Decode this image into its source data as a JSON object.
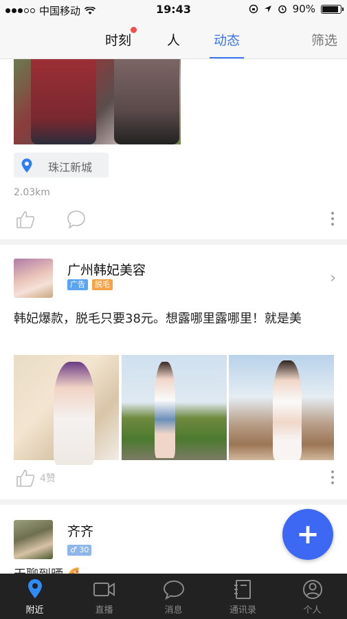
{
  "status_bar": {
    "carrier": "中国移动",
    "time": "19:43",
    "battery": "90%"
  },
  "nav": {
    "tabs": [
      {
        "label": "时刻"
      },
      {
        "label": "人"
      },
      {
        "label": "动态"
      }
    ],
    "filter_label": "筛选"
  },
  "feed": {
    "first_post": {
      "location": "珠江新城",
      "distance": "2.03km"
    },
    "ad_post": {
      "name": "广州韩妃美容",
      "badge_ad": "广告",
      "badge_tag": "脱毛",
      "text": "韩妃爆款，脱毛只要38元。想露哪里露哪里！就是美",
      "likes": "4赞"
    },
    "third_post": {
      "name": "齐齐",
      "gender_age": "♂ 30",
      "text_preview": "天聊到晒 🍕"
    }
  },
  "fab": {
    "label": "+"
  },
  "bottom_nav": {
    "items": [
      {
        "label": "附近",
        "icon": "location-pin-icon"
      },
      {
        "label": "直播",
        "icon": "video-camera-icon"
      },
      {
        "label": "消息",
        "icon": "chat-bubble-icon"
      },
      {
        "label": "通讯录",
        "icon": "contacts-book-icon"
      },
      {
        "label": "个人",
        "icon": "person-icon"
      }
    ]
  },
  "colors": {
    "accent": "#3a74f0",
    "fab": "#3c68f3",
    "badge_ad": "#5aa4f0",
    "badge_tag": "#f5a44a",
    "bottom_bar": "#222222"
  }
}
